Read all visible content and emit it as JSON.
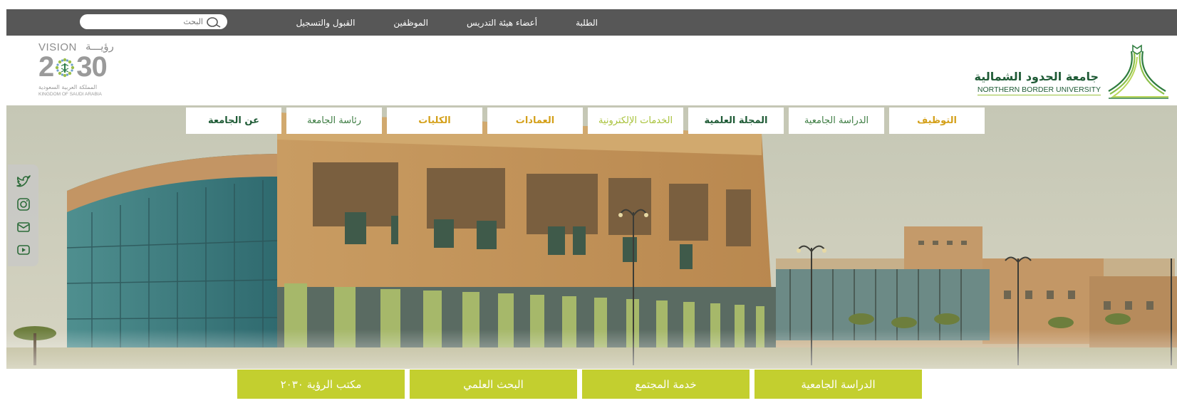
{
  "topbar": {
    "links": [
      "الطلبة",
      "أعضاء هيئة التدريس",
      "الموظفين",
      "القبول والتسجيل"
    ],
    "search_placeholder": "البحث"
  },
  "header": {
    "vision_en": "VISION",
    "vision_ar": "رؤيـــة",
    "vision_year_left": "2",
    "vision_year_right": "30",
    "vision_kingdom_ar": "المملكة العربية السعودية",
    "vision_kingdom_en": "KINGDOM OF SAUDI ARABIA",
    "university_ar": "جامعة الحدود الشمالية",
    "university_en": "NORTHERN BORDER UNIVERSITY"
  },
  "mainnav": [
    {
      "label": "عن الجامعة",
      "style": "dark"
    },
    {
      "label": "رئاسة الجامعة",
      "style": "plain"
    },
    {
      "label": "الكليات",
      "style": "gold"
    },
    {
      "label": "العمادات",
      "style": "gold"
    },
    {
      "label": "الخدمات الإلكترونية",
      "style": "lime"
    },
    {
      "label": "المجلة العلمية",
      "style": "dark"
    },
    {
      "label": "الدراسة الجامعية",
      "style": "plain"
    },
    {
      "label": "التوظيف",
      "style": "gold"
    }
  ],
  "social": [
    "twitter-icon",
    "instagram-icon",
    "mail-icon",
    "youtube-icon"
  ],
  "quicklinks": [
    "مكتب الرؤية ٢٠٣٠",
    "البحث العلمي",
    "خدمة المجتمع",
    "الدراسة الجامعية"
  ],
  "colors": {
    "topbar": "#575757",
    "brand_green": "#1f5b36",
    "accent_lime": "#c3cf2f",
    "accent_gold": "#d4a01a"
  }
}
